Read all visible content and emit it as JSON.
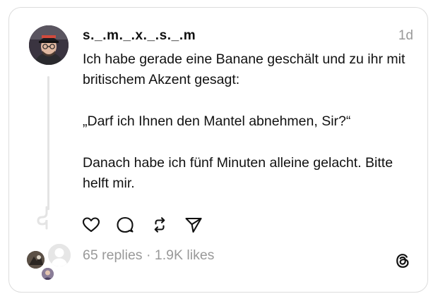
{
  "post": {
    "username": "s._.m._.x._.s._.m",
    "timestamp": "1d",
    "text_lines": [
      "Ich habe gerade eine Banane geschält und zu ihr mit britischem Akzent gesagt:",
      "„Darf ich Ihnen den Mantel abnehmen, Sir?“",
      "Danach habe ich fünf Minuten alleine gelacht. Bitte helft mir."
    ],
    "stats": "65 replies · 1.9K likes"
  },
  "actions": {
    "like_icon": "heart-icon",
    "reply_icon": "comment-bubble-icon",
    "repost_icon": "repost-icon",
    "share_icon": "send-icon"
  },
  "brand": {
    "logo_icon": "threads-logo-icon"
  },
  "colors": {
    "text": "#111111",
    "muted": "#999999",
    "border": "#dcdcdc"
  }
}
